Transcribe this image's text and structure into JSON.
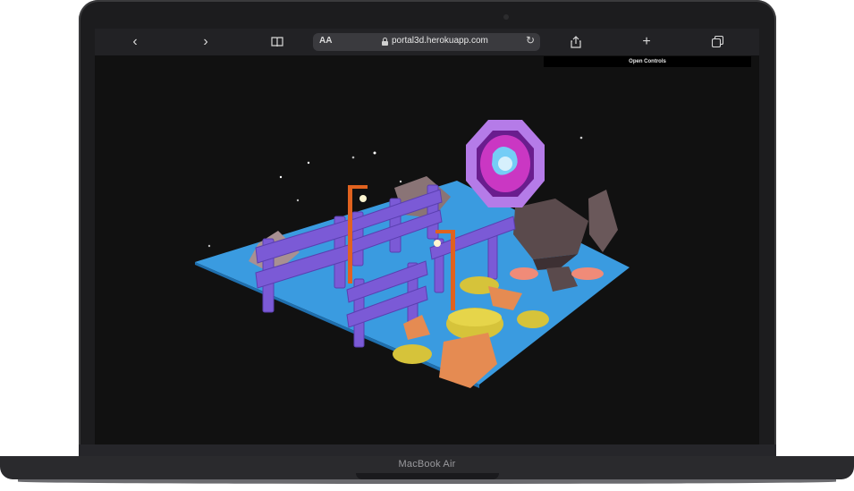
{
  "browser": {
    "url": "portal3d.herokuapp.com",
    "reader_label": "AA",
    "buttons": [
      "back",
      "forward",
      "bookmarks",
      "share",
      "new-tab",
      "tabs"
    ]
  },
  "page": {
    "controls_label": "Open Controls",
    "scene_description_icon": "3d-portal-scene"
  },
  "device": {
    "name": "MacBook Air"
  },
  "colors": {
    "background": "#111111",
    "floor": "#3a9be0",
    "fence": "#7b5ad6",
    "portal": "#b57be8",
    "portal_glow": "#e23fd1",
    "rocks": "#5a4a4c",
    "stones": "#e58b52",
    "moss": "#d6c33a"
  }
}
